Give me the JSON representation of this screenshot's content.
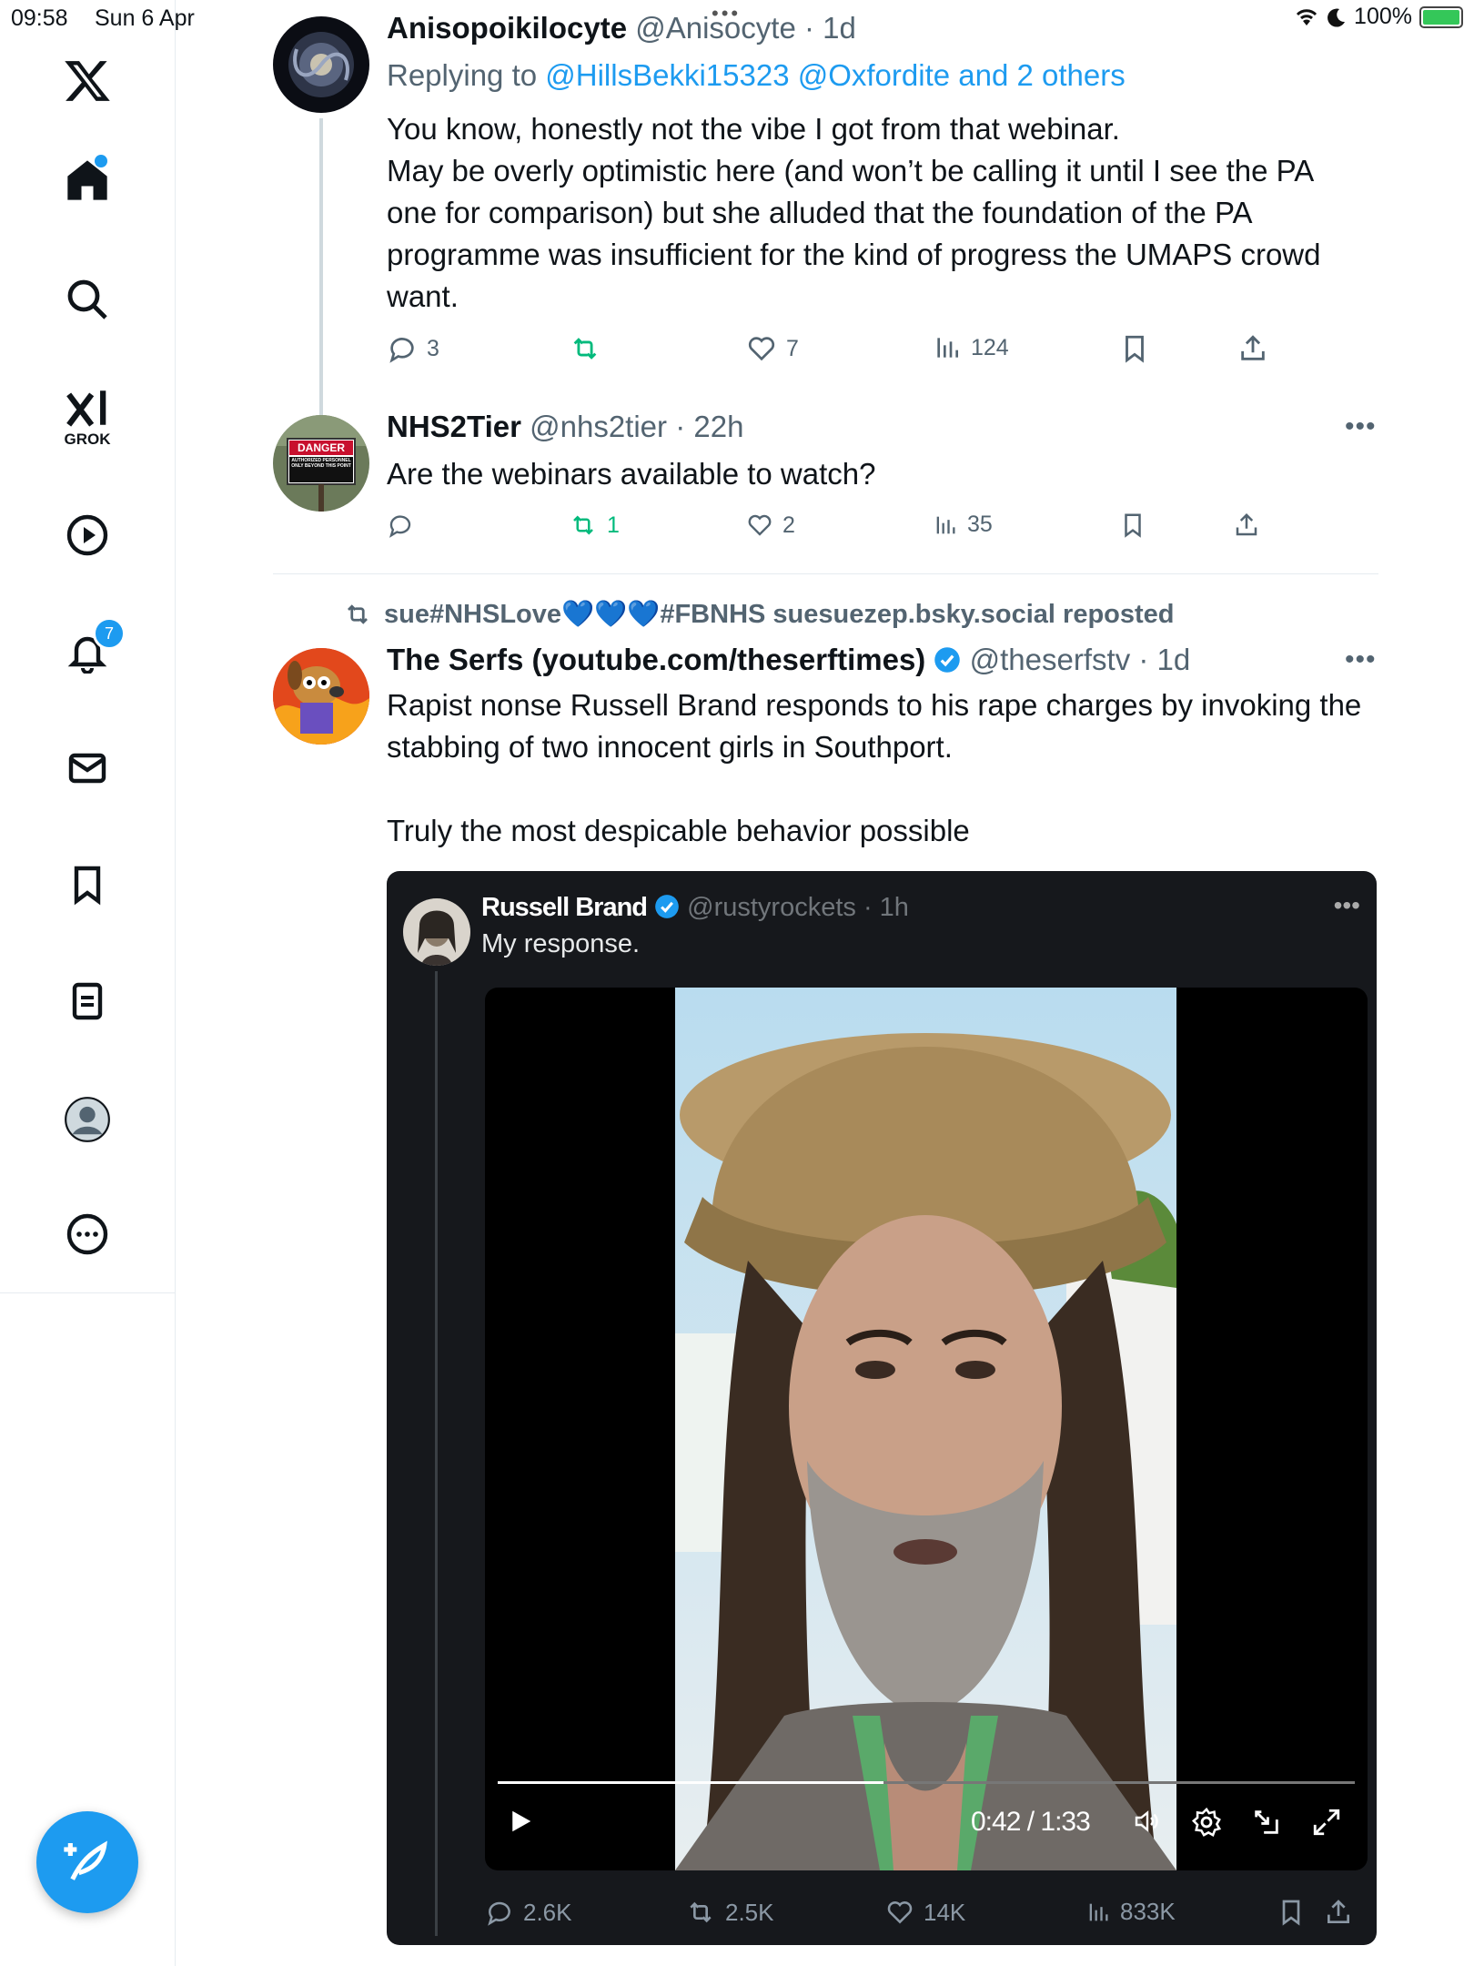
{
  "status_bar": {
    "time": "09:58",
    "date": "Sun 6 Apr",
    "battery": "100%"
  },
  "sidebar": {
    "grok_label": "GROK",
    "notifications_badge": "7"
  },
  "tweets": [
    {
      "name": "Anisopoikilocyte",
      "handle": "@Anisocyte",
      "time": "1d",
      "replying_prefix": "Replying to ",
      "replying_to": "@HillsBekki15323 @Oxfordite and 2 others",
      "text": "You know, honestly not the vibe I got from that webinar.\nMay be overly optimistic here (and won’t be calling it until I see the PA one for comparison) but she alluded that the foundation of the PA programme was insufficient for the kind of progress the UMAPS crowd want.",
      "replies": "3",
      "reposts": "",
      "likes": "7",
      "views": "124"
    },
    {
      "name": "NHS2Tier",
      "handle": "@nhs2tier",
      "time": "22h",
      "text": "Are the webinars available to watch?",
      "avatar_sign": "DANGER",
      "avatar_sub": "AUTHORIZED PERSONNEL ONLY BEYOND THIS POINT",
      "replies": "",
      "reposts": "1",
      "likes": "2",
      "views": "35"
    },
    {
      "repost_label": "sue#NHSLove💙💙💙#FBNHS suesuezep.bsky.social reposted",
      "name": "The Serfs (youtube.com/theserftimes)",
      "handle": "@theserfstv",
      "time": "1d",
      "text": "Rapist nonse Russell Brand responds to his rape charges by invoking the stabbing of two innocent girls in Southport.\n\nTruly the most despicable behavior possible",
      "embed": {
        "name": "Russell Brand",
        "handle": "@rustyrockets",
        "time": "1h",
        "text": "My response.",
        "video_time": "0:42 / 1:33",
        "video_played_fraction": 0.45,
        "replies": "2.6K",
        "reposts": "2.5K",
        "likes": "14K",
        "views": "833K"
      }
    }
  ],
  "colors": {
    "accent": "#1d9bf0",
    "repost_green": "#00ba7c",
    "muted": "#536471"
  }
}
